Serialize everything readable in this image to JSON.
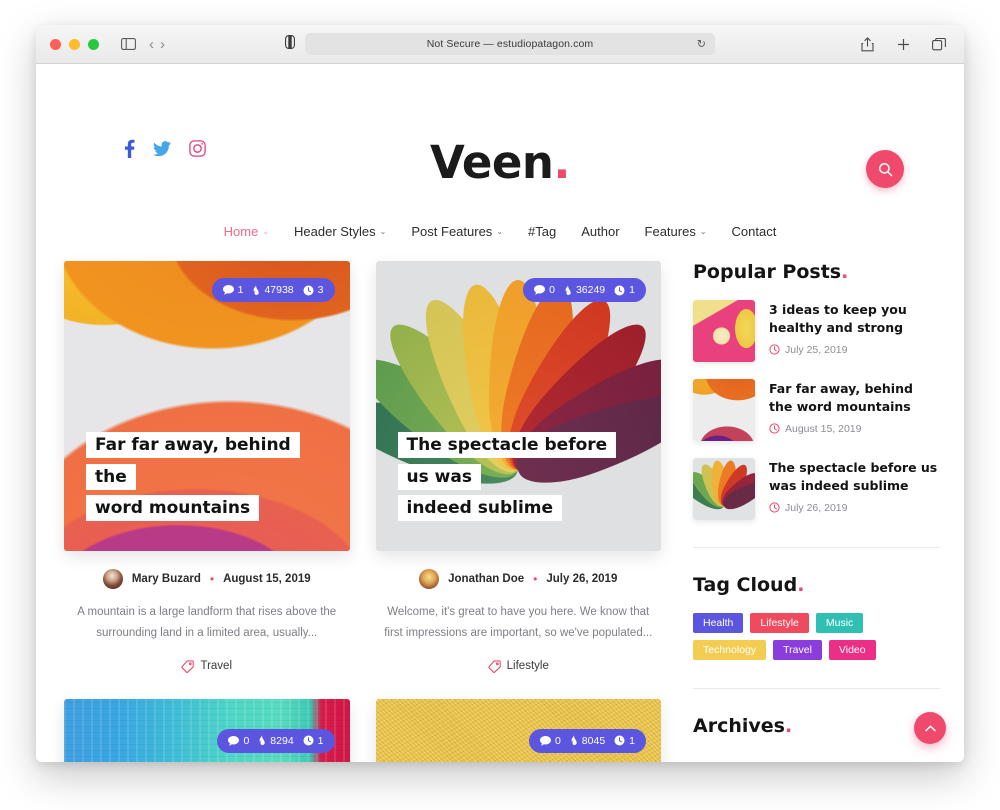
{
  "browser": {
    "url_text": "Not Secure — estudiopatagon.com",
    "reload_glyph": "↻",
    "back_glyph": "‹",
    "forward_glyph": "›",
    "share_glyph": "⇪",
    "newtab_glyph": "+",
    "tabs_glyph": "⧉"
  },
  "site": {
    "logo": "Veen",
    "logo_dot": ".",
    "social": [
      {
        "name": "facebook",
        "color": "#3b5bdb"
      },
      {
        "name": "twitter",
        "color": "#45a7e8"
      },
      {
        "name": "instagram",
        "color": "#e1407a"
      }
    ],
    "search_label": "Search"
  },
  "nav": [
    {
      "label": "Home",
      "caret": "⌄",
      "active": true
    },
    {
      "label": "Header Styles",
      "caret": "⌄",
      "active": false
    },
    {
      "label": "Post Features",
      "caret": "⌄",
      "active": false
    },
    {
      "label": "#Tag",
      "caret": "",
      "active": false
    },
    {
      "label": "Author",
      "caret": "",
      "active": false
    },
    {
      "label": "Features",
      "caret": "⌄",
      "active": false
    },
    {
      "label": "Contact",
      "caret": "",
      "active": false
    }
  ],
  "posts": [
    {
      "image": "abstract-gradient-waves",
      "title_line1": "Far far away, behind the",
      "title_line2": "word mountains",
      "comments": "1",
      "views": "47938",
      "readtime": "3",
      "author": "Mary Buzard",
      "separator": "•",
      "date": "August 15, 2019",
      "excerpt": "A mountain is a large landform that rises above the surrounding land in a limited area, usually...",
      "category": "Travel"
    },
    {
      "image": "autumn-leaves-fan",
      "title_line1": "The spectacle before us was",
      "title_line2": "indeed sublime",
      "comments": "0",
      "views": "36249",
      "readtime": "1",
      "author": "Jonathan Doe",
      "separator": "•",
      "date": "July 26, 2019",
      "excerpt": "Welcome, it's great to have you here. We know that first impressions are important, so we've populated...",
      "category": "Lifestyle"
    },
    {
      "image": "blue-teal-paint",
      "comments": "0",
      "views": "8294",
      "readtime": "1"
    },
    {
      "image": "yellow-stucco-wall",
      "comments": "0",
      "views": "8045",
      "readtime": "1"
    }
  ],
  "sidebar": {
    "popular": {
      "title": "Popular Posts",
      "title_dot": ".",
      "items": [
        {
          "title": "3 ideas to keep you healthy and strong",
          "date": "July 25, 2019",
          "thumb": "food-soup-banana"
        },
        {
          "title": "Far far away, behind the word mountains",
          "date": "August 15, 2019",
          "thumb": "abstract-gradient-waves"
        },
        {
          "title": "The spectacle before us was indeed sublime",
          "date": "July 26, 2019",
          "thumb": "autumn-leaves-fan"
        }
      ]
    },
    "tagcloud": {
      "title": "Tag Cloud",
      "title_dot": ".",
      "tags": [
        {
          "label": "Health",
          "color": "#5b55e0"
        },
        {
          "label": "Lifestyle",
          "color": "#ef4a5e"
        },
        {
          "label": "Music",
          "color": "#2fbfb4"
        },
        {
          "label": "Technology",
          "color": "#f5cc52"
        },
        {
          "label": "Travel",
          "color": "#8b3ddb"
        },
        {
          "label": "Video",
          "color": "#ec2f86"
        }
      ]
    },
    "archives": {
      "title": "Archives",
      "title_dot": "."
    }
  },
  "scroll_top": {
    "glyph": "⌃"
  },
  "theme": {
    "accent_pink": "#ef4a6b",
    "badge_purple": "#5b55e0"
  }
}
